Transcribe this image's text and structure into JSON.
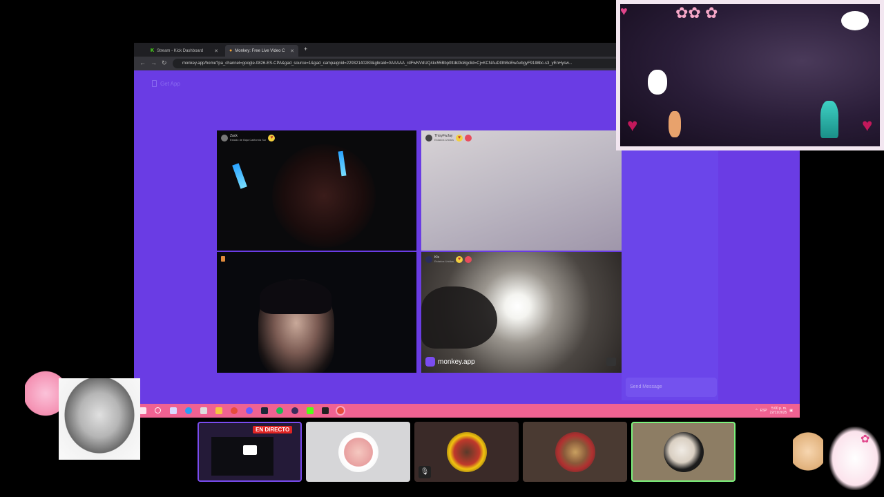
{
  "browser": {
    "tabs": [
      {
        "label": "Stream - Kick Dashboard",
        "icon": "kick-icon"
      },
      {
        "label": "Monkey: Free Live Video C",
        "icon": "monkey-icon"
      }
    ],
    "new_tab": "+",
    "url": "monkey.app/home?pa_channel=google-0826-ES-CPA&gad_source=1&gad_campaignid=22932140283&gbraid=0AAAAA_rdFwNVdUQ4kc55Bbp0ttdkl3o8gclid=Cj=KCNAuDl3hBoEwAvbgyF91Il8bc-s3_yEnHysw..."
  },
  "page": {
    "get_app_label": "Get App",
    "tiles": [
      {
        "name": "Zack",
        "location": "Estado de Baja California Sur"
      },
      {
        "name": "ThisyFwJay",
        "location": "Estados Unidos"
      },
      {
        "name": "",
        "location": ""
      },
      {
        "name": "Kls",
        "location": "Estados Unidos",
        "watermark": "monkey.app"
      }
    ],
    "send_message_placeholder": "Send Message"
  },
  "taskbar": {
    "clock": "5:00 p. m.",
    "date": "22/11/2025",
    "lang": "ESP"
  },
  "stream": {
    "live_badge": "EN DIRECTO",
    "guest_icons": [
      "mic-off-icon"
    ]
  },
  "colors": {
    "page_bg": "#6a3ce4",
    "taskbar": "#f06292",
    "live_badge": "#e02424",
    "active_guest_border": "#7cf27c"
  }
}
